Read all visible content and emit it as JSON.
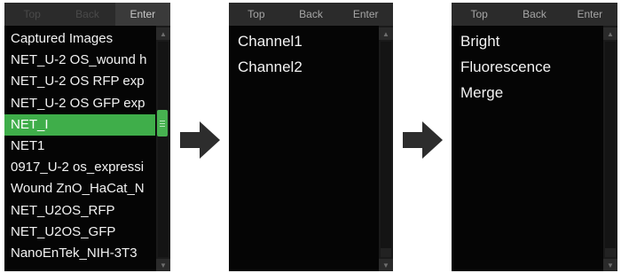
{
  "panel1": {
    "tabs": [
      "Top",
      "Back",
      "Enter"
    ],
    "items": [
      "Captured Images",
      "NET_U-2 OS_wound h",
      "NET_U-2 OS RFP exp",
      "NET_U-2 OS GFP exp",
      "NET_I",
      "NET1",
      "0917_U-2 os_expressi",
      "Wound ZnO_HaCat_N",
      "NET_U2OS_RFP",
      "NET_U2OS_GFP",
      "NanoEnTek_NIH-3T3"
    ],
    "selected_index": 4
  },
  "panel2": {
    "tabs": [
      "Top",
      "Back",
      "Enter"
    ],
    "items": [
      "Channel1",
      "Channel2"
    ]
  },
  "panel3": {
    "tabs": [
      "Top",
      "Back",
      "Enter"
    ],
    "items": [
      "Bright",
      "Fluorescence",
      "Merge"
    ]
  },
  "icons": {
    "arrow": "right-arrow-icon",
    "scroll_up": "scroll-up-icon",
    "scroll_down": "scroll-down-icon"
  },
  "colors": {
    "selection": "#3fae4a",
    "panel_bg": "#050505",
    "tab_bg": "#2b2b2b",
    "arrow": "#2d2d2d"
  }
}
